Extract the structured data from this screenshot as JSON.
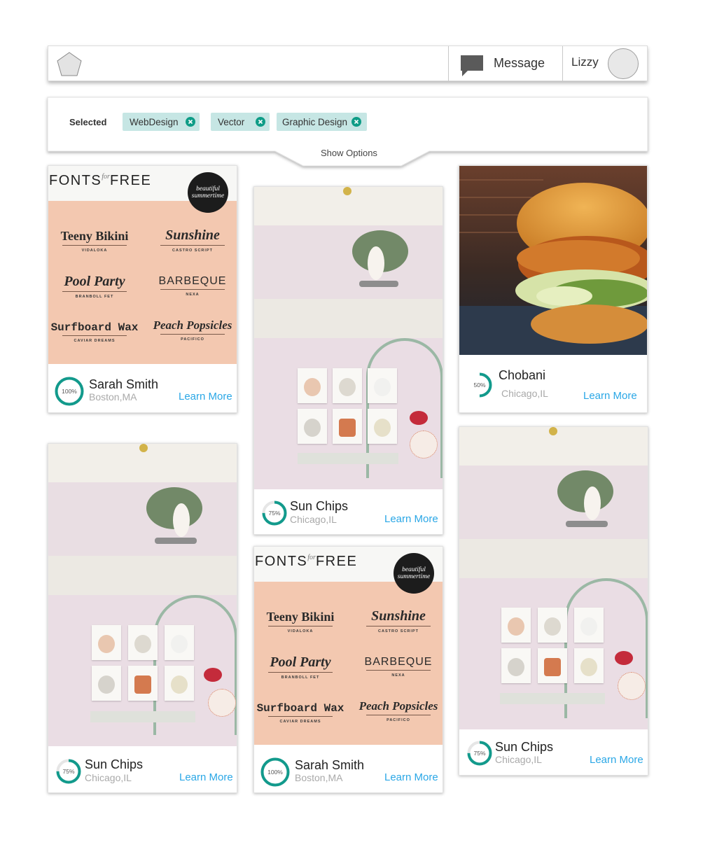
{
  "header": {
    "message_label": "Message",
    "user_name": "Lizzy"
  },
  "filters": {
    "selected_label": "Selected",
    "tags": [
      "WebDesign",
      "Vector",
      "Graphic Design"
    ],
    "show_options_label": "Show Options",
    "accent_color": "#0e9c86",
    "chip_color": "#c6e6e4"
  },
  "fonts_poster": {
    "brand": "FONTS",
    "brand_for": "for",
    "brand_free": "FREE",
    "badge_line1": "beautiful",
    "badge_line2": "summertime",
    "fonts": [
      {
        "name": "Teeny Bikini",
        "sub": "VIDALOKA"
      },
      {
        "name": "Sunshine",
        "sub": "CASTRO SCRIPT"
      },
      {
        "name": "Pool Party",
        "sub": "BRANBOLL FET"
      },
      {
        "name": "BARBEQUE",
        "sub": "NEXA"
      },
      {
        "name": "Surfboard Wax",
        "sub": "CAVIAR DREAMS"
      },
      {
        "name": "Peach Popsicles",
        "sub": "PACIFICO"
      }
    ]
  },
  "cards": [
    {
      "name": "Sarah Smith",
      "location": "Boston,MA",
      "progress_label": "100%",
      "progress": 1.0,
      "link": "Learn More",
      "image": "fonts-poster"
    },
    {
      "name": "Sun Chips",
      "location": "Chicago,IL",
      "progress_label": "75%",
      "progress": 0.75,
      "link": "Learn More",
      "image": "still-life"
    },
    {
      "name": "Chobani",
      "location": "Chicago,IL",
      "progress_label": "50%",
      "progress": 0.5,
      "link": "Learn More",
      "image": "burger-photo"
    },
    {
      "name": "Sun Chips",
      "location": "Chicago,IL",
      "progress_label": "75%",
      "progress": 0.75,
      "link": "Learn More",
      "image": "still-life"
    },
    {
      "name": "Sarah Smith",
      "location": "Boston,MA",
      "progress_label": "100%",
      "progress": 1.0,
      "link": "Learn More",
      "image": "fonts-poster"
    },
    {
      "name": "Sun Chips",
      "location": "Chicago,IL",
      "progress_label": "75%",
      "progress": 0.75,
      "link": "Learn More",
      "image": "still-life"
    }
  ]
}
